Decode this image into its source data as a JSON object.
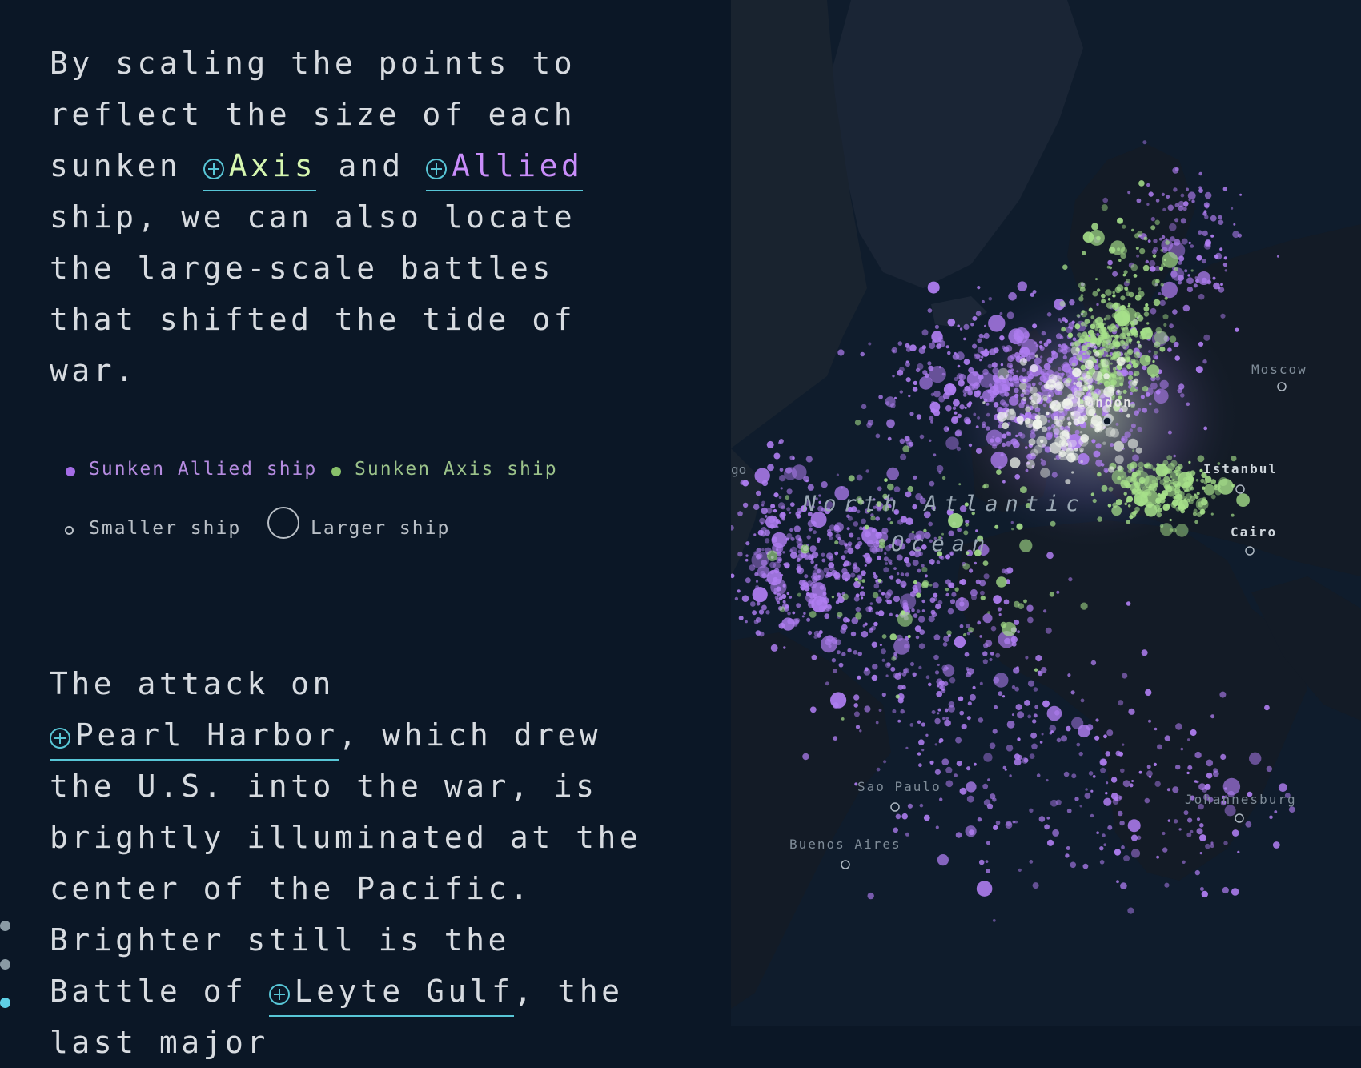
{
  "story": {
    "paragraph_1": {
      "before": "By scaling the points to reflect the size of each sunken ",
      "link_axis": "Axis",
      "between": " and ",
      "link_allied": "Allied",
      "after": " ship, we can also locate the large-scale battles that shifted the tide of war."
    },
    "legend": {
      "allied": "Sunken Allied ship",
      "axis": "Sunken Axis ship",
      "smaller": "Smaller ship",
      "larger": "Larger ship"
    },
    "paragraph_2": {
      "before": "The attack on ",
      "link": "Pearl Harbor",
      "after": ", which drew the U.S. into the war, is brightly illuminated at the center of the Pacific."
    },
    "paragraph_3": {
      "before": "Brighter still is the Battle of ",
      "link": "Leyte Gulf",
      "after": ", the last major"
    }
  },
  "progress": {
    "colors": [
      "#8a9aa4",
      "#8a9aa4",
      "#5fd0e6"
    ]
  },
  "colors": {
    "allied": "#b07ef2",
    "axis": "#a6e08a",
    "link_underline": "#58c6d6",
    "background": "#0b1726"
  },
  "map": {
    "ocean_label_line1": "North Atlantic",
    "ocean_label_line2": "Ocean",
    "cities": [
      {
        "name": "London"
      },
      {
        "name": "Moscow"
      },
      {
        "name": "Istanbul"
      },
      {
        "name": "Cairo"
      },
      {
        "name": "Sao Paulo"
      },
      {
        "name": "Buenos Aires"
      },
      {
        "name": "Johannesburg"
      }
    ],
    "edge_label": "go"
  }
}
